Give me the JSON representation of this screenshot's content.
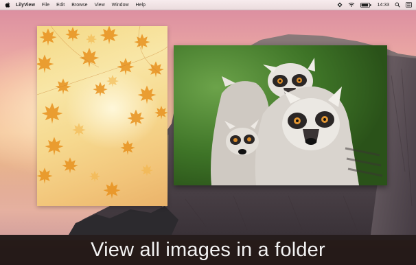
{
  "menubar": {
    "app_name": "LilyView",
    "menus": [
      "File",
      "Edit",
      "Browse",
      "View",
      "Window",
      "Help"
    ],
    "clock": "14:33",
    "status_icons": [
      "app-status-icon",
      "wifi-icon",
      "battery-icon",
      "search-icon",
      "notification-center-icon"
    ]
  },
  "caption": "View all images in a folder",
  "images": [
    {
      "subject": "autumn leaves",
      "icon": "leaf-image"
    },
    {
      "subject": "ring-tailed lemurs",
      "icon": "lemur-image"
    }
  ],
  "colors": {
    "caption_bg": "#000000",
    "caption_text": "#f2f2f2",
    "leaf_orange": "#e8921f",
    "lemur_green": "#3f7428"
  }
}
